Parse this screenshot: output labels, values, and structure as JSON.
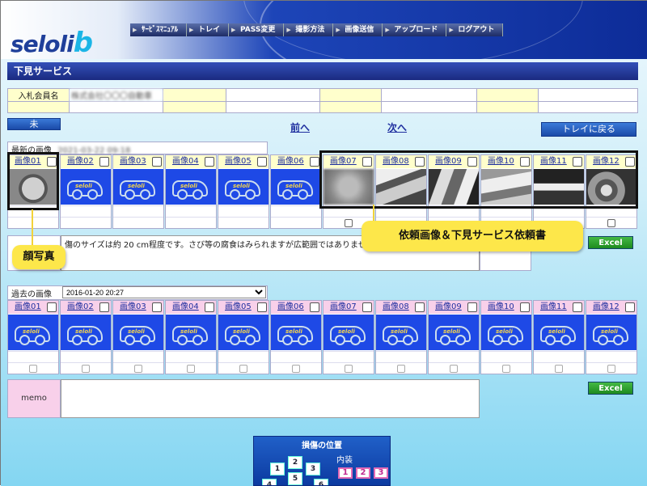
{
  "app": {
    "logo_text": "seloli",
    "logo_b": "b"
  },
  "nav": [
    "ｻｰﾋﾞｽﾏﾆｭｱﾙ",
    "トレイ",
    "PASS変更",
    "撮影方法",
    "画像送信",
    "アップロード",
    "ログアウト"
  ],
  "page_title": "下見サービス",
  "member": {
    "label": "入札会員名",
    "value": "株式会社〇〇〇自動車"
  },
  "status_button": "未",
  "links": {
    "prev": "前へ",
    "next": "次へ"
  },
  "tray_button": "トレイに戻る",
  "latest": {
    "label": "最新の画像",
    "date": "2021-03-22 09:18",
    "headers": [
      "画像01",
      "画像02",
      "画像03",
      "画像04",
      "画像05",
      "画像06",
      "画像07",
      "画像08",
      "画像09",
      "画像10",
      "画像11",
      "画像12"
    ],
    "kinds": [
      "photo-face",
      "placeholder",
      "placeholder",
      "placeholder",
      "placeholder",
      "placeholder",
      "photo-blur",
      "photo-cargo",
      "photo-door",
      "photo-bed",
      "photo-dark",
      "photo-engine"
    ],
    "checked_row_flags": [
      false,
      false,
      false,
      false,
      false,
      false,
      true,
      false,
      false,
      false,
      false,
      true
    ],
    "comment": "傷のサイズは約 20 cm程度です。さび等の腐食はみられますが広範囲ではありません (4"
  },
  "excel_label": "Excel",
  "callouts": {
    "face_photo": "顔写真",
    "request": "依頼画像＆下見サービス依頼書"
  },
  "past": {
    "label": "過去の画像",
    "select_value": "2016-01-20 20:27",
    "headers": [
      "画像01",
      "画像02",
      "画像03",
      "画像04",
      "画像05",
      "画像06",
      "画像07",
      "画像08",
      "画像09",
      "画像10",
      "画像11",
      "画像12"
    ],
    "memo_label": "memo"
  },
  "damage": {
    "title": "損傷の位置",
    "interior_label": "内装",
    "seats": [
      "1",
      "2",
      "3",
      "4",
      "5",
      "6"
    ],
    "interior_buttons": [
      "1",
      "2",
      "3"
    ]
  },
  "colors": {
    "nav_bg": "#1d2c66",
    "title_bar": "#1a2a80",
    "thumb_blue": "#1e49e6",
    "callout_yellow": "#fde74a",
    "excel_green": "#1e8a1e"
  }
}
